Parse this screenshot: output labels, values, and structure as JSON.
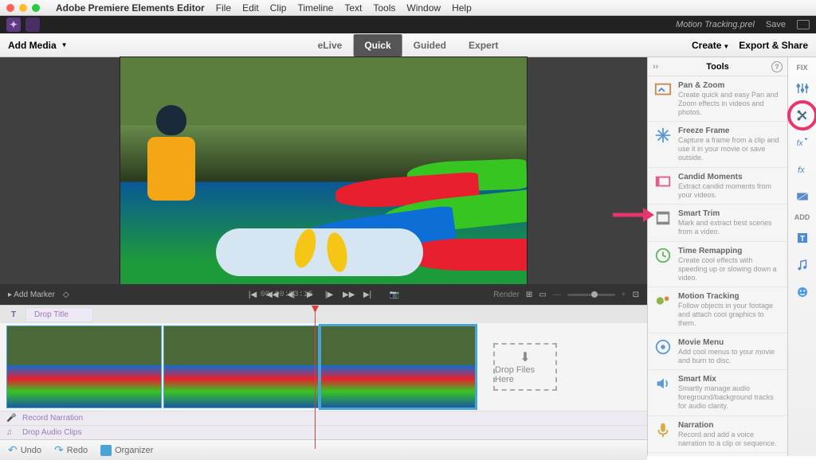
{
  "macos": {
    "app_name": "Adobe Premiere Elements Editor",
    "menus": [
      "File",
      "Edit",
      "Clip",
      "Timeline",
      "Text",
      "Tools",
      "Window",
      "Help"
    ]
  },
  "titlebar": {
    "document": "Motion Tracking.prel",
    "save": "Save"
  },
  "toolbar": {
    "add_media": "Add Media",
    "tabs": [
      "eLive",
      "Quick",
      "Guided",
      "Expert"
    ],
    "active_tab": "Quick",
    "create": "Create",
    "export_share": "Export & Share"
  },
  "playback": {
    "add_marker": "Add Marker",
    "timecode": "00:00:03:15",
    "render": "Render"
  },
  "timeline": {
    "drop_title": "Drop Title",
    "drop_files": "Drop Files Here",
    "record_narration": "Record Narration",
    "drop_audio": "Drop Audio Clips"
  },
  "footer": {
    "undo": "Undo",
    "redo": "Redo",
    "organizer": "Organizer"
  },
  "tools_panel": {
    "title": "Tools",
    "items": [
      {
        "title": "Pan & Zoom",
        "desc": "Create quick and easy Pan and Zoom effects in videos and photos."
      },
      {
        "title": "Freeze Frame",
        "desc": "Capture a frame from a clip and use it in your movie or save outside."
      },
      {
        "title": "Candid Moments",
        "desc": "Extract candid moments from your videos."
      },
      {
        "title": "Smart Trim",
        "desc": "Mark and extract best scenes from a video."
      },
      {
        "title": "Time Remapping",
        "desc": "Create cool effects with speeding up or slowing down a video."
      },
      {
        "title": "Motion Tracking",
        "desc": "Follow objects in your footage and attach cool graphics to them."
      },
      {
        "title": "Movie Menu",
        "desc": "Add cool menus to your movie and burn to disc."
      },
      {
        "title": "Smart Mix",
        "desc": "Smartly manage audio foreground/background tracks for audio clarity."
      },
      {
        "title": "Narration",
        "desc": "Record and add a voice narration to a clip or sequence."
      }
    ]
  },
  "strip": {
    "fix": "FIX",
    "add": "ADD"
  }
}
